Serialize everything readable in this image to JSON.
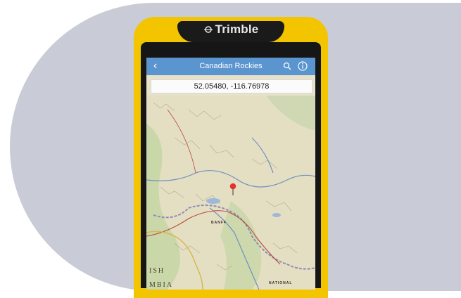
{
  "brand": {
    "name": "Trimble"
  },
  "app": {
    "title": "Canadian Rockies",
    "coordinates": "52.05480, -116.76978"
  },
  "icons": {
    "back": "chevron-left-icon",
    "search": "search-icon",
    "info": "info-icon",
    "pin": "map-pin-icon"
  },
  "map_labels": {
    "banff": "BANFF",
    "national": "NATIONAL",
    "ish": "ISH",
    "mbia": "MBIA"
  },
  "colors": {
    "appbar": "#5a95cf",
    "device_bumper": "#f2c500",
    "background_shape": "#c9cbd6",
    "pin": "#e5322d"
  }
}
